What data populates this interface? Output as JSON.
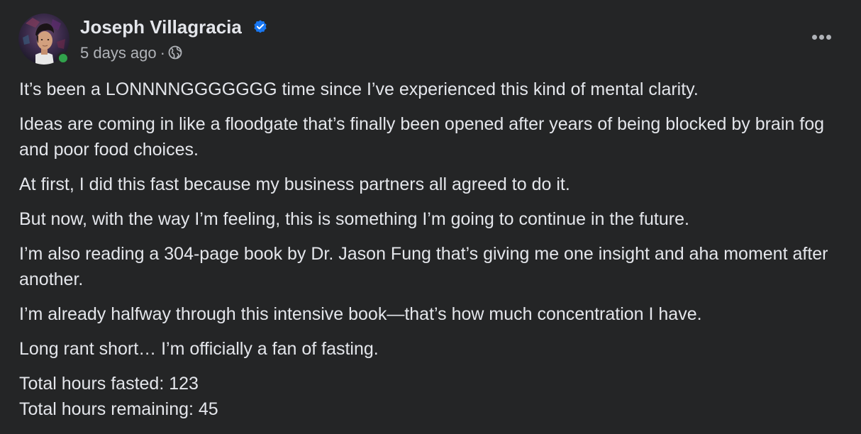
{
  "post": {
    "author": {
      "name": "Joseph Villagracia",
      "verified_icon": "verified-badge-icon",
      "status": "online",
      "online_color": "#31a24c"
    },
    "meta": {
      "time": "5 days ago",
      "separator": "·",
      "audience_icon": "globe-icon"
    },
    "paragraphs": [
      "It’s been a LONNNNGGGGGGG time since I’ve experienced this kind of mental clarity.",
      "Ideas are coming in like a floodgate that’s finally been opened after years of being blocked by brain fog and poor food choices.",
      "At first, I did this fast because my business partners all agreed to do it.",
      "But now, with the way I’m feeling, this is something I’m going to continue in the future.",
      "I’m also reading a 304-page book by Dr. Jason Fung that’s giving me one insight and aha moment after another.",
      "I’m already halfway through this intensive book—that’s how much concentration I have.",
      "Long rant short… I’m officially a fan of fasting.",
      "Total hours fasted: 123\nTotal hours remaining: 45"
    ]
  },
  "colors": {
    "background": "#242526",
    "primary_text": "#e4e6eb",
    "secondary_text": "#b0b3b8",
    "verified_blue": "#1877f2"
  }
}
